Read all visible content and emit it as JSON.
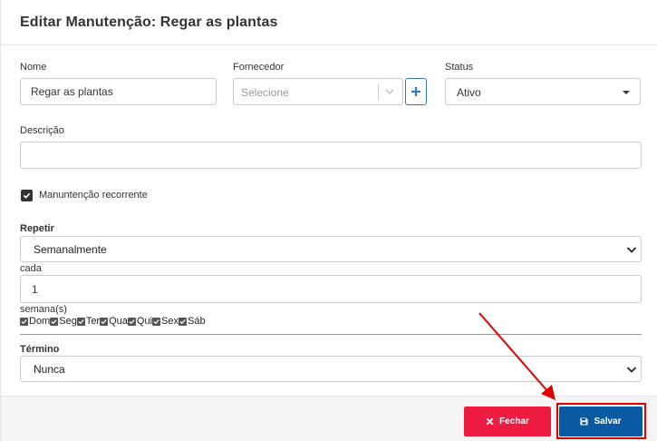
{
  "modal": {
    "title": "Editar Manutenção: Regar as plantas"
  },
  "form": {
    "nome": {
      "label": "Nome",
      "value": "Regar as plantas"
    },
    "fornecedor": {
      "label": "Fornecedor",
      "placeholder": "Selecione"
    },
    "status": {
      "label": "Status",
      "value": "Ativo"
    },
    "descricao": {
      "label": "Descrição",
      "value": ""
    },
    "recorrente": {
      "label": "Manuntenção recorrente",
      "checked": true
    },
    "repetir": {
      "label": "Repetir",
      "value": "Semanalmente"
    },
    "cada": {
      "label": "cada",
      "value": "1"
    },
    "semanas_label": "semana(s)",
    "days": [
      "Dom",
      "Seg",
      "Ter",
      "Qua",
      "Qui",
      "Sex",
      "Sáb"
    ],
    "termino": {
      "label": "Término",
      "value": "Nunca"
    }
  },
  "footer": {
    "close_label": "Fechar",
    "save_label": "Salvar"
  },
  "colors": {
    "close": "#ee1c40",
    "save": "#0a5aa3",
    "annotation": "#e10000"
  },
  "icons": {
    "close": "times-icon",
    "save": "floppy-disk-icon",
    "add": "plus-icon"
  }
}
